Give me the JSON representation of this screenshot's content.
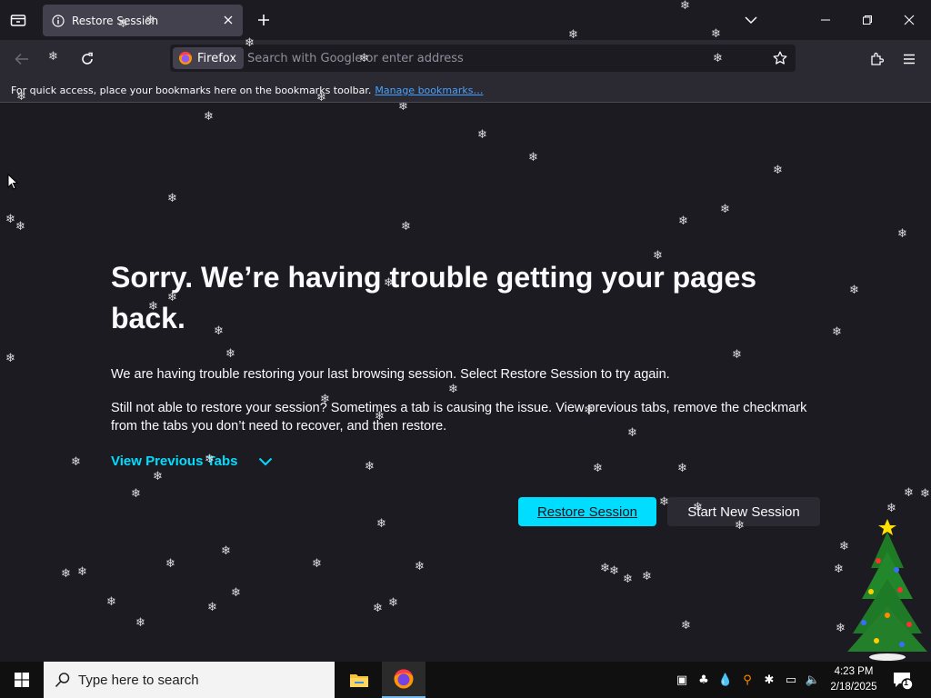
{
  "browser": {
    "tab": {
      "title": "Restore Session"
    },
    "urlbar": {
      "identity_label": "Firefox",
      "placeholder": "Search with Google or enter address"
    },
    "bookmarks_bar": {
      "message": "For quick access, place your bookmarks here on the bookmarks toolbar.",
      "link": "Manage bookmarks…"
    }
  },
  "page": {
    "heading": "Sorry. We’re having trouble getting your pages back.",
    "paragraph1": "We are having trouble restoring your last browsing session. Select Restore Session to try again.",
    "paragraph2": "Still not able to restore your session? Sometimes a tab is causing the issue. View previous tabs, remove the checkmark from the tabs you don’t need to recover, and then restore.",
    "view_previous_tabs": "View Previous Tabs",
    "restore_button": "Restore Session",
    "new_session_button": "Start New Session"
  },
  "taskbar": {
    "search_placeholder": "Type here to search",
    "clock_time": "4:23 PM",
    "clock_date": "2/18/2025",
    "notification_count": "1"
  },
  "colors": {
    "accent": "#00ddff",
    "link": "#45a1ff",
    "background": "#1c1b22",
    "toolbar": "#2b2a33"
  },
  "icons": [
    "tab-list-icon",
    "info-icon",
    "close-icon",
    "plus-icon",
    "chevron-down-icon",
    "minimize-icon",
    "maximize-icon",
    "back-icon",
    "reload-icon",
    "firefox-logo-icon",
    "star-icon",
    "extensions-icon",
    "menu-icon",
    "windows-start-icon",
    "search-icon",
    "file-explorer-icon",
    "firefox-icon",
    "notification-icon",
    "christmas-tree-icon",
    "snowflake-icon"
  ]
}
